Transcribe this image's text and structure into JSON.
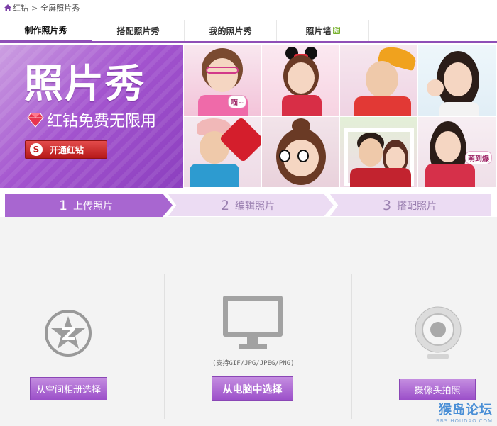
{
  "breadcrumb": {
    "home_icon": "home-icon",
    "item1": "红钻",
    "separator": ">",
    "item2": "全屏照片秀"
  },
  "tabs": [
    {
      "label": "制作照片秀",
      "active": true
    },
    {
      "label": "搭配照片秀",
      "active": false
    },
    {
      "label": "我的照片秀",
      "active": false
    },
    {
      "label": "照片墙",
      "active": false,
      "badge": "新"
    }
  ],
  "promo": {
    "title": "照片秀",
    "subtitle": "红钻免费无限用",
    "open_button": "开通红钻",
    "diamond_icon": "red-diamond-icon",
    "brand_color": "#a455cf"
  },
  "photo_grid": {
    "bubble_1": "喵~",
    "bubble_2": "萌到爆"
  },
  "steps": [
    {
      "num": "1",
      "label": "上传照片",
      "active": true
    },
    {
      "num": "2",
      "label": "编辑照片",
      "active": false
    },
    {
      "num": "3",
      "label": "搭配照片",
      "active": false
    }
  ],
  "upload": {
    "qzone_button": "从空间相册选择",
    "computer_hint": "(支持GIF/JPG/JPEG/PNG)",
    "computer_button": "从电脑中选择",
    "camera_button": "摄像头拍照"
  },
  "watermark": {
    "text": "猴岛论坛",
    "url": "BBS.HOUDAO.COM"
  },
  "colors": {
    "accent": "#8f4fb7",
    "step_active": "#a866d0",
    "step_inactive": "#ecdcf3",
    "button_top": "#c48de0",
    "button_bottom": "#9b4fc9"
  }
}
